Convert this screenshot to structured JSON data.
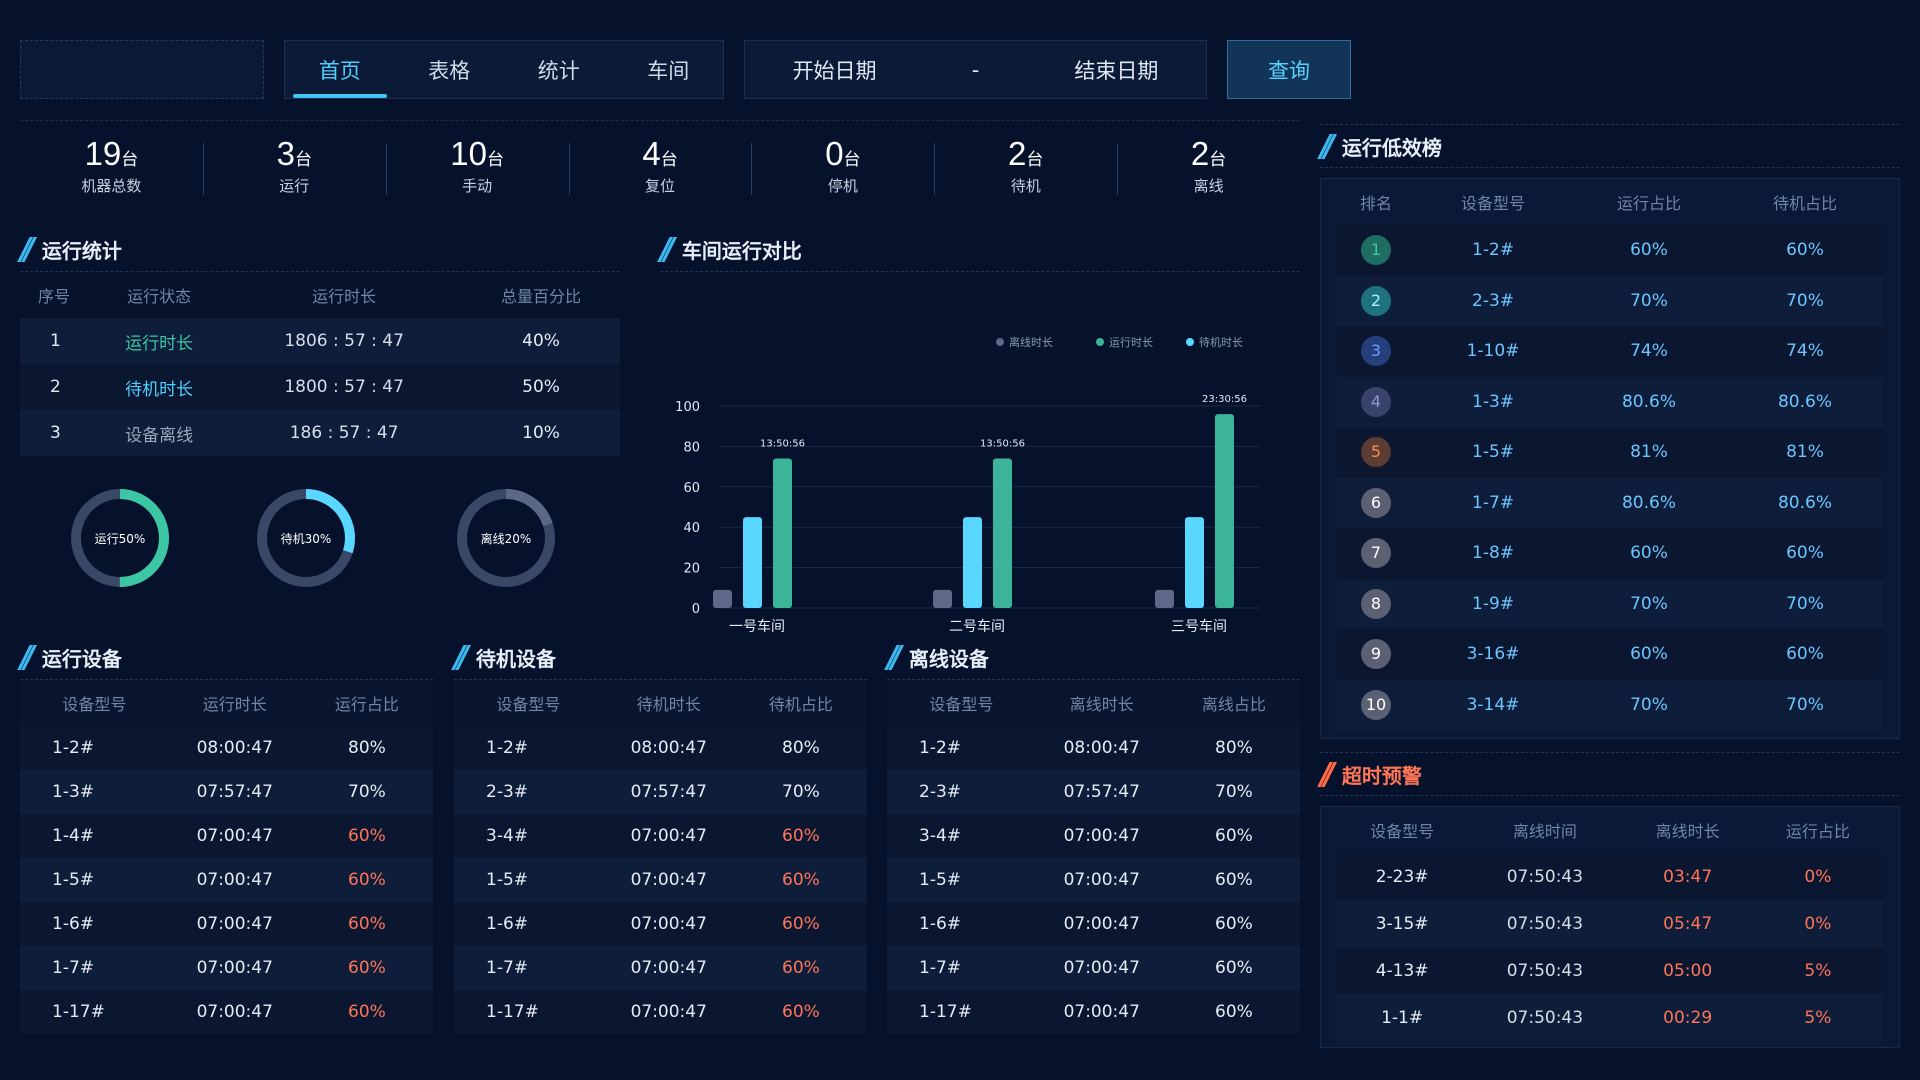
{
  "nav": {
    "tabs": [
      {
        "label": "首页",
        "active": true
      },
      {
        "label": "表格",
        "active": false
      },
      {
        "label": "统计",
        "active": false
      },
      {
        "label": "车间",
        "active": false
      }
    ],
    "start_date": "开始日期",
    "date_sep": "-",
    "end_date": "结束日期",
    "query_label": "查询"
  },
  "stats": [
    {
      "value": "19",
      "unit": "台",
      "label": "机器总数"
    },
    {
      "value": "3",
      "unit": "台",
      "label": "运行"
    },
    {
      "value": "10",
      "unit": "台",
      "label": "手动"
    },
    {
      "value": "4",
      "unit": "台",
      "label": "复位"
    },
    {
      "value": "0",
      "unit": "台",
      "label": "停机"
    },
    {
      "value": "2",
      "unit": "台",
      "label": "待机"
    },
    {
      "value": "2",
      "unit": "台",
      "label": "离线"
    }
  ],
  "run_stats": {
    "title": "运行统计",
    "headers": [
      "序号",
      "运行状态",
      "运行时长",
      "总量百分比"
    ],
    "rows": [
      [
        "1",
        "运行时长",
        "1806 : 57 : 47",
        "40%"
      ],
      [
        "2",
        "待机时长",
        "1800 : 57 : 47",
        "50%"
      ],
      [
        "3",
        "设备离线",
        "186 : 57 : 47",
        "10%"
      ]
    ],
    "donuts": [
      {
        "label": "运行50%",
        "value": 0.5,
        "color": "#3cc6a4"
      },
      {
        "label": "待机30%",
        "value": 0.3,
        "color": "#5ad7ff"
      },
      {
        "label": "离线20%",
        "value": 0.2,
        "color": "#5b6786"
      }
    ]
  },
  "workshop": {
    "title": "车间运行对比",
    "legend": [
      "离线时长",
      "运行时长",
      "待机时长"
    ],
    "chart_data": {
      "type": "bar",
      "categories": [
        "一号车间",
        "二号车间",
        "三号车间"
      ],
      "series": [
        {
          "name": "离线时长",
          "values": [
            9,
            9,
            9
          ],
          "color": "#5e6888"
        },
        {
          "name": "待机时长",
          "values": [
            45,
            45,
            45
          ],
          "color": "#5ad7ff"
        },
        {
          "name": "运行时长",
          "values": [
            74,
            74,
            96
          ],
          "color": "#3cb49a"
        }
      ],
      "labels": [
        "13:50:56",
        "13:50:56",
        "23:30:56"
      ],
      "yticks": [
        "0",
        "20",
        "40",
        "60",
        "80",
        "100"
      ],
      "ylim": [
        0,
        100
      ]
    }
  },
  "running": {
    "title": "运行设备",
    "headers": [
      "设备型号",
      "运行时长",
      "运行占比"
    ],
    "rows": [
      [
        "1-2#",
        "08:00:47",
        "80%"
      ],
      [
        "1-3#",
        "07:57:47",
        "70%"
      ],
      [
        "1-4#",
        "07:00:47",
        "60%"
      ],
      [
        "1-5#",
        "07:00:47",
        "60%"
      ],
      [
        "1-6#",
        "07:00:47",
        "60%"
      ],
      [
        "1-7#",
        "07:00:47",
        "60%"
      ],
      [
        "1-17#",
        "07:00:47",
        "60%"
      ]
    ]
  },
  "standby": {
    "title": "待机设备",
    "headers": [
      "设备型号",
      "待机时长",
      "待机占比"
    ],
    "rows": [
      [
        "1-2#",
        "08:00:47",
        "80%"
      ],
      [
        "2-3#",
        "07:57:47",
        "70%"
      ],
      [
        "3-4#",
        "07:00:47",
        "60%"
      ],
      [
        "1-5#",
        "07:00:47",
        "60%"
      ],
      [
        "1-6#",
        "07:00:47",
        "60%"
      ],
      [
        "1-7#",
        "07:00:47",
        "60%"
      ],
      [
        "1-17#",
        "07:00:47",
        "60%"
      ]
    ]
  },
  "offline": {
    "title": "离线设备",
    "headers": [
      "设备型号",
      "离线时长",
      "离线占比"
    ],
    "rows": [
      [
        "1-2#",
        "08:00:47",
        "80%"
      ],
      [
        "2-3#",
        "07:57:47",
        "70%"
      ],
      [
        "3-4#",
        "07:00:47",
        "60%"
      ],
      [
        "1-5#",
        "07:00:47",
        "60%"
      ],
      [
        "1-6#",
        "07:00:47",
        "60%"
      ],
      [
        "1-7#",
        "07:00:47",
        "60%"
      ],
      [
        "1-17#",
        "07:00:47",
        "60%"
      ]
    ]
  },
  "low_eff": {
    "title": "运行低效榜",
    "headers": [
      "排名",
      "设备型号",
      "运行占比",
      "待机占比"
    ],
    "rows": [
      {
        "rank": "1",
        "model": "1-2#",
        "run": "60%",
        "standby": "60%",
        "color": "#1f6c62",
        "text": "#3cc6a4"
      },
      {
        "rank": "2",
        "model": "2-3#",
        "run": "70%",
        "standby": "70%",
        "color": "#1f7381",
        "text": "#a6f0ff"
      },
      {
        "rank": "3",
        "model": "1-10#",
        "run": "74%",
        "standby": "74%",
        "color": "#253f7c",
        "text": "#6c9bff"
      },
      {
        "rank": "4",
        "model": "1-3#",
        "run": "80.6%",
        "standby": "80.6%",
        "color": "#39426b",
        "text": "#8f9ad0"
      },
      {
        "rank": "5",
        "model": "1-5#",
        "run": "81%",
        "standby": "81%",
        "color": "#5b3d33",
        "text": "#ff8c53"
      },
      {
        "rank": "6",
        "model": "1-7#",
        "run": "80.6%",
        "standby": "80.6%",
        "color": "#5b6073",
        "text": "#ffffff"
      },
      {
        "rank": "7",
        "model": "1-8#",
        "run": "60%",
        "standby": "60%",
        "color": "#5b6073",
        "text": "#ffffff"
      },
      {
        "rank": "8",
        "model": "1-9#",
        "run": "70%",
        "standby": "70%",
        "color": "#5b6073",
        "text": "#ffffff"
      },
      {
        "rank": "9",
        "model": "3-16#",
        "run": "60%",
        "standby": "60%",
        "color": "#5b6073",
        "text": "#ffffff"
      },
      {
        "rank": "10",
        "model": "3-14#",
        "run": "70%",
        "standby": "70%",
        "color": "#5b6073",
        "text": "#ffffff"
      }
    ]
  },
  "timeout": {
    "title": "超时预警",
    "headers": [
      "设备型号",
      "离线时间",
      "离线时长",
      "运行占比"
    ],
    "rows": [
      [
        "2-23#",
        "07:50:43",
        "03:47",
        "0%"
      ],
      [
        "3-15#",
        "07:50:43",
        "05:47",
        "0%"
      ],
      [
        "4-13#",
        "07:50:43",
        "05:00",
        "5%"
      ],
      [
        "1-1#",
        "07:50:43",
        "00:29",
        "5%"
      ]
    ]
  }
}
